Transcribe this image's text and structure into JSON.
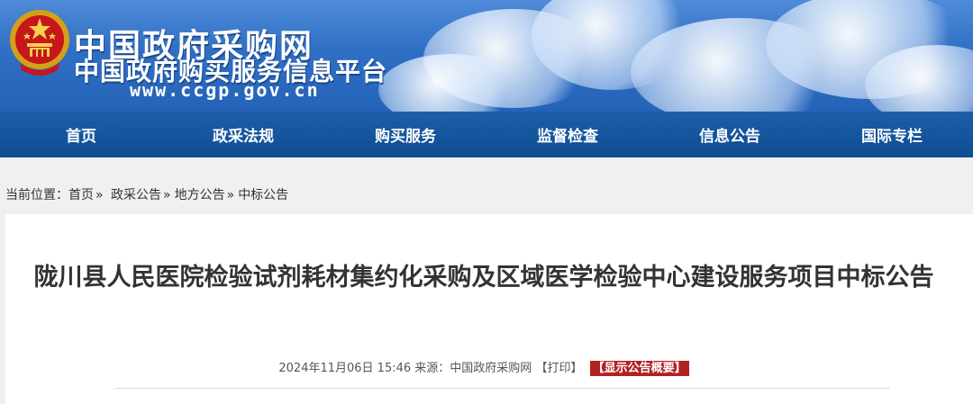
{
  "header": {
    "site_name": "中国政府采购网",
    "site_subtitle": "中国政府购买服务信息平台",
    "site_url": "www.ccgp.gov.cn",
    "emblem_icon": "national-emblem-icon",
    "colors": {
      "banner": "#2f6fc4",
      "nav": "#1b5ea8",
      "summary_badge": "#b22222"
    }
  },
  "nav": {
    "items": [
      {
        "label": "首页"
      },
      {
        "label": "政采法规"
      },
      {
        "label": "购买服务"
      },
      {
        "label": "监督检查"
      },
      {
        "label": "信息公告"
      },
      {
        "label": "国际专栏"
      }
    ]
  },
  "breadcrumb": {
    "prefix": "当前位置：",
    "items": [
      "首页",
      "政采公告",
      "地方公告",
      "中标公告"
    ],
    "separator": "»"
  },
  "article": {
    "title": "陇川县人民医院检验试剂耗材集约化采购及区域医学检验中心建设服务项目中标公告",
    "datetime": "2024年11月06日 15:46",
    "source_label": "来源：",
    "source": "中国政府采购网",
    "print_label": "【打印】",
    "summary_label": "【显示公告概要】"
  }
}
